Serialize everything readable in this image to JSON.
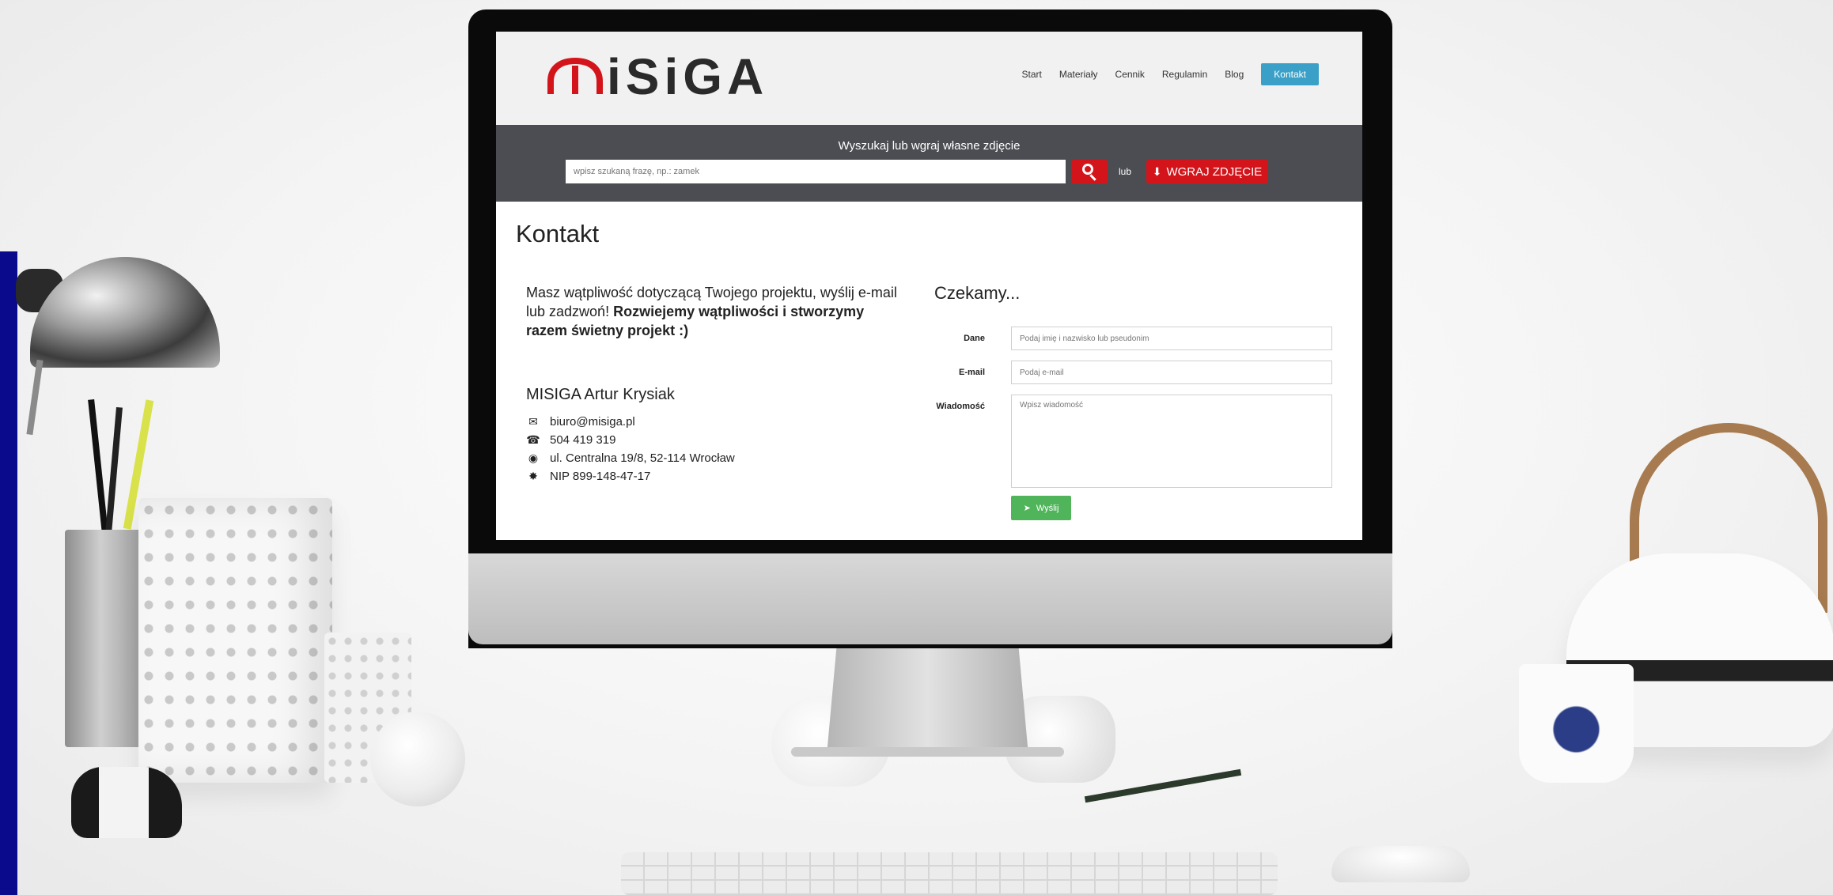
{
  "colors": {
    "brand_red": "#d3151b",
    "nav_active": "#3aa0c7",
    "search_band": "#4b4d52",
    "send_green": "#4fb45a",
    "left_strip": "#0a0a8c"
  },
  "logo": {
    "text": "iSiGA"
  },
  "nav": {
    "items": [
      {
        "label": "Start",
        "active": false
      },
      {
        "label": "Materiały",
        "active": false
      },
      {
        "label": "Cennik",
        "active": false
      },
      {
        "label": "Regulamin",
        "active": false
      },
      {
        "label": "Blog",
        "active": false
      },
      {
        "label": "Kontakt",
        "active": true
      }
    ]
  },
  "search": {
    "caption": "Wyszukaj lub wgraj własne zdjęcie",
    "placeholder": "wpisz szukaną frazę, np.: zamek",
    "or_label": "lub",
    "upload_label": "WGRAJ ZDJĘCIE",
    "upload_icon": "download-icon",
    "search_icon": "search-icon"
  },
  "page": {
    "title": "Kontakt"
  },
  "intro": {
    "text": "Masz wątpliwość dotyczącą Twojego projektu, wyślij e-mail lub zadzwoń! ",
    "bold": "Rozwiejemy wątpliwości i stworzymy razem świetny projekt :)"
  },
  "company": {
    "name": "MISIGA Artur Krysiak",
    "contacts": [
      {
        "icon": "envelope-icon",
        "value": "biuro@misiga.pl"
      },
      {
        "icon": "phone-icon",
        "value": "504 419 319"
      },
      {
        "icon": "globe-icon",
        "value": "ul. Centralna 19/8, 52-114 Wrocław"
      },
      {
        "icon": "certificate-icon",
        "value": "NIP 899-148-47-17"
      }
    ]
  },
  "form": {
    "title": "Czekamy...",
    "name_label": "Dane",
    "name_placeholder": "Podaj imię i nazwisko lub pseudonim",
    "email_label": "E-mail",
    "email_placeholder": "Podaj e-mail",
    "message_label": "Wiadomość",
    "message_placeholder": "Wpisz wiadomość",
    "send_label": "Wyślij",
    "send_icon": "send-icon"
  }
}
